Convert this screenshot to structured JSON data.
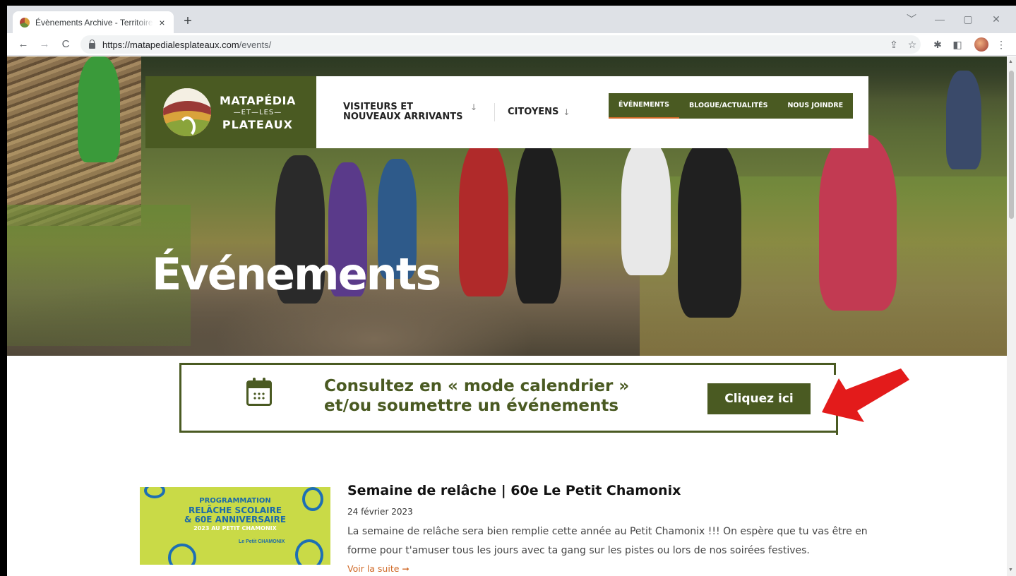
{
  "browser": {
    "tab_title": "Évènements Archive - Territoire MRC",
    "tab_close": "×",
    "new_tab": "+",
    "url_host": "https://matapedialesplateaux.com",
    "url_path": "/events/",
    "window_controls": [
      "﹀",
      "—",
      "▢",
      "✕"
    ]
  },
  "header": {
    "logo": {
      "line1": "MATAPÉDIA",
      "line2": "—ET—LES—",
      "line3": "PLATEAUX"
    },
    "nav": [
      {
        "label": "VISITEURS ET NOUVEAUX ARRIVANTS",
        "arrow": "↓"
      },
      {
        "label": "CITOYENS",
        "arrow": "↓"
      }
    ],
    "pill_nav": [
      "ÉVÉNEMENTS",
      "BLOGUE/ACTUALITÉS",
      "NOUS JOINDRE"
    ]
  },
  "hero": {
    "title": "Événements"
  },
  "callout": {
    "text_line1": "Consultez en « mode calendrier »",
    "text_line2": "et/ou soumettre un événements",
    "button": "Cliquez ici"
  },
  "event": {
    "title": "Semaine de relâche | 60e Le Petit Chamonix",
    "date": "24 février 2023",
    "description": "La semaine de relâche sera bien remplie cette année au Petit Chamonix !!! On espère que tu vas être en forme pour t'amuser tous les jours avec ta gang sur les pistes ou lors de nos soirées festives.",
    "read_more": "Voir la suite ➞",
    "thumb": {
      "line1": "PROGRAMMATION",
      "line2": "RELÂCHE SCOLAIRE",
      "line3": "& 60E ANNIVERSAIRE",
      "line4": "2023 AU PETIT CHAMONIX",
      "brand": "Le Petit CHAMONIX"
    }
  },
  "colors": {
    "brand_green": "#4a5a22",
    "accent_orange": "#d06a28",
    "arrow_red": "#e31b1b"
  }
}
